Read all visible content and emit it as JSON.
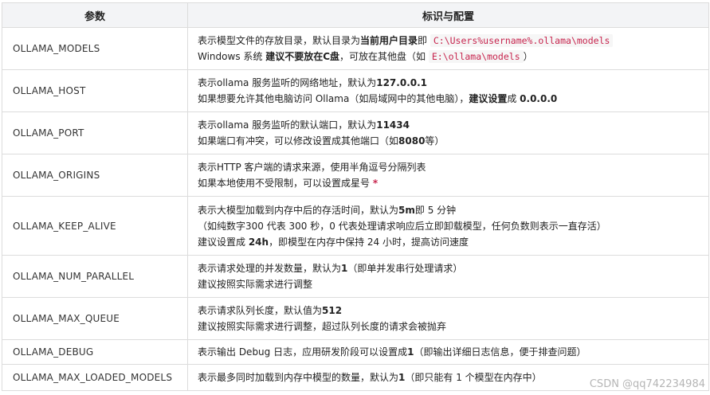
{
  "header": {
    "col_param": "参数",
    "col_desc": "标识与配置"
  },
  "rows": [
    {
      "name": "OLLAMA_MODELS",
      "l1a": "表示模型文件的存放目录，默认目录为",
      "l1b": "当前用户目录",
      "l1c": "即 ",
      "l1code": "C:\\Users%username%.ollama\\models",
      "l2a": "Windows 系统 ",
      "l2b": "建议不要放在C盘",
      "l2c": "，可放在其他盘（如 ",
      "l2code": "E:\\ollama\\models",
      "l2d": "）"
    },
    {
      "name": "OLLAMA_HOST",
      "l1a": "表示ollama 服务监听的网络地址，默认为",
      "l1b": "127.0.0.1",
      "l2a": "如果想要允许其他电脑访问 Ollama（如局域网中的其他电脑），",
      "l2b": "建议设置",
      "l2c": "成 ",
      "l2d": "0.0.0.0"
    },
    {
      "name": "OLLAMA_PORT",
      "l1a": "表示ollama 服务监听的默认端口，默认为",
      "l1b": "11434",
      "l2a": "如果端口有冲突，可以修改设置成其他端口（如",
      "l2b": "8080",
      "l2c": "等）"
    },
    {
      "name": "OLLAMA_ORIGINS",
      "l1a": "表示HTTP 客户端的请求来源，使用半角逗号分隔列表",
      "l2a": "如果本地使用不受限制，可以设置成星号 ",
      "l2star": "*"
    },
    {
      "name": "OLLAMA_KEEP_ALIVE",
      "l1a": "表示大模型加载到内存中后的存活时间，默认为",
      "l1b": "5m",
      "l1c": "即 5 分钟",
      "l2a": "（如纯数字300 代表 300 秒，0 代表处理请求响应后立即卸载模型，任何负数则表示一直存活）",
      "l3a": "建议设置成 ",
      "l3b": "24h",
      "l3c": "，即模型在内存中保持 24 小时，提高访问速度"
    },
    {
      "name": "OLLAMA_NUM_PARALLEL",
      "l1a": "表示请求处理的并发数量，默认为",
      "l1b": "1",
      "l1c": "（即单并发串行处理请求）",
      "l2a": "建议按照实际需求进行调整"
    },
    {
      "name": "OLLAMA_MAX_QUEUE",
      "l1a": "表示请求队列长度，默认值为",
      "l1b": "512",
      "l2a": "建议按照实际需求进行调整，超过队列长度的请求会被抛弃"
    },
    {
      "name": "OLLAMA_DEBUG",
      "l1a": "表示输出 Debug 日志，应用研发阶段可以设置成",
      "l1b": "1",
      "l1c": "（即输出详细日志信息，便于排查问题）"
    },
    {
      "name": "OLLAMA_MAX_LOADED_MODELS",
      "l1a": "表示最多同时加载到内存中模型的数量，默认为",
      "l1b": "1",
      "l1c": "（即只能有 1 个模型在内存中）"
    }
  ],
  "watermark": "CSDN @qq742234984"
}
